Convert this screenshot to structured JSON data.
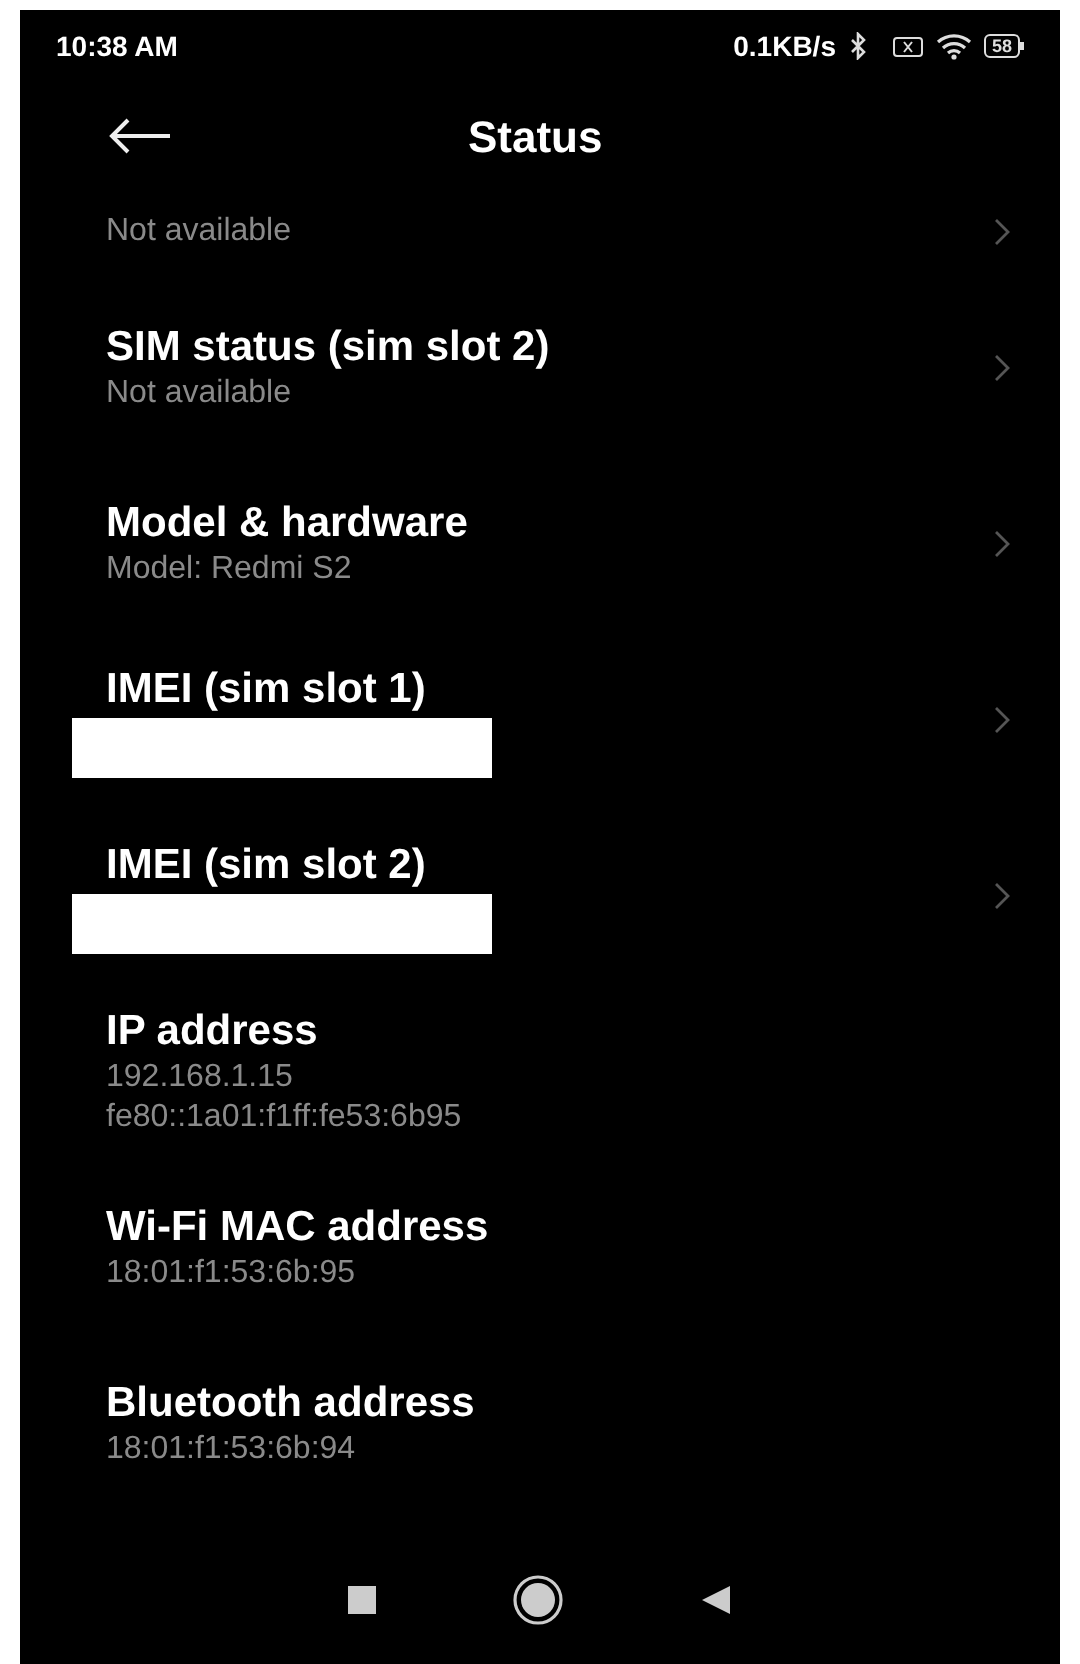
{
  "status_bar": {
    "time": "10:38 AM",
    "speed": "0.1KB/s",
    "battery": "58"
  },
  "header": {
    "title": "Status"
  },
  "items": [
    {
      "lines": [
        "Not available"
      ],
      "chevron": true,
      "redacted": false,
      "cut": true
    },
    {
      "title": "SIM status (sim slot 2)",
      "lines": [
        "Not available"
      ],
      "chevron": true,
      "redacted": false,
      "cut": false
    },
    {
      "title": "Model & hardware",
      "lines": [
        "Model: Redmi S2"
      ],
      "chevron": true,
      "redacted": false,
      "cut": false
    },
    {
      "title": "IMEI (sim slot 1)",
      "chevron": true,
      "redacted": true,
      "cut": false
    },
    {
      "title": "IMEI (sim slot 2)",
      "chevron": true,
      "redacted": true,
      "cut": false
    },
    {
      "title": "IP address",
      "lines": [
        "192.168.1.15",
        "fe80::1a01:f1ff:fe53:6b95"
      ],
      "chevron": false,
      "redacted": false,
      "cut": false
    },
    {
      "title": "Wi-Fi MAC address",
      "lines": [
        "18:01:f1:53:6b:95"
      ],
      "chevron": false,
      "redacted": false,
      "cut": false
    },
    {
      "title": "Bluetooth address",
      "lines": [
        "18:01:f1:53:6b:94"
      ],
      "chevron": false,
      "redacted": false,
      "cut": false
    }
  ]
}
